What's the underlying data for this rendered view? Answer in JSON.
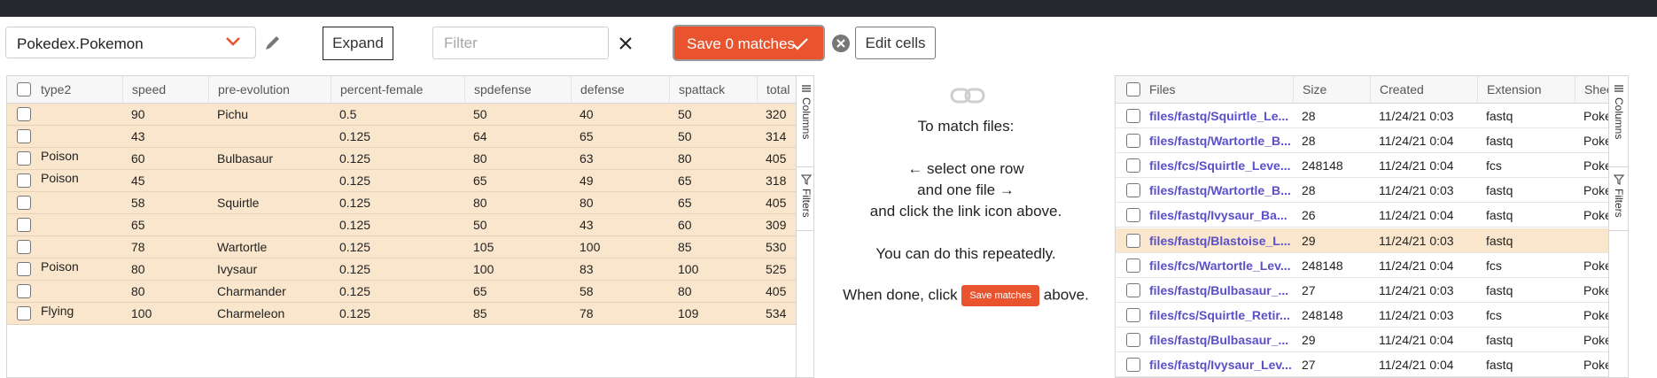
{
  "toolbar": {
    "dataset_select": "Pokedex.Pokemon",
    "expand_label": "Expand",
    "filter_placeholder": "Filter",
    "filter_value": "",
    "save_label": "Save 0 matches",
    "edit_cells_label": "Edit cells",
    "accent_color": "#e9542f"
  },
  "left_grid": {
    "columns": [
      "type2",
      "speed",
      "pre-evolution",
      "percent-female",
      "spdefense",
      "defense",
      "spattack",
      "total"
    ],
    "rows": [
      [
        "",
        "90",
        "Pichu",
        "0.5",
        "50",
        "40",
        "50",
        "320"
      ],
      [
        "",
        "43",
        "",
        "0.125",
        "64",
        "65",
        "50",
        "314"
      ],
      [
        "Poison",
        "60",
        "Bulbasaur",
        "0.125",
        "80",
        "63",
        "80",
        "405"
      ],
      [
        "Poison",
        "45",
        "",
        "0.125",
        "65",
        "49",
        "65",
        "318"
      ],
      [
        "",
        "58",
        "Squirtle",
        "0.125",
        "80",
        "80",
        "65",
        "405"
      ],
      [
        "",
        "65",
        "",
        "0.125",
        "50",
        "43",
        "60",
        "309"
      ],
      [
        "",
        "78",
        "Wartortle",
        "0.125",
        "105",
        "100",
        "85",
        "530"
      ],
      [
        "Poison",
        "80",
        "Ivysaur",
        "0.125",
        "100",
        "83",
        "100",
        "525"
      ],
      [
        "",
        "80",
        "Charmander",
        "0.125",
        "65",
        "58",
        "80",
        "405"
      ],
      [
        "Flying",
        "100",
        "Charmeleon",
        "0.125",
        "85",
        "78",
        "109",
        "534"
      ]
    ],
    "side_tabs": [
      "Columns",
      "Filters"
    ]
  },
  "instructions": {
    "line1": "To match files:",
    "line2": "← select one row",
    "line3": "and one file →",
    "line4": "and click the link icon above.",
    "line5": "You can do this repeatedly.",
    "line6_pre": "When done, click",
    "line6_button": "Save matches",
    "line6_post": "above."
  },
  "right_grid": {
    "columns": [
      "Files",
      "Size",
      "Created",
      "Extension",
      "Sheets"
    ],
    "rows": [
      {
        "file": "files/fastq/Squirtle_Le...",
        "size": "28",
        "created": "11/24/21 0:03",
        "ext": "fastq",
        "sheets": "Poked",
        "hl": false
      },
      {
        "file": "files/fastq/Wartortle_B...",
        "size": "28",
        "created": "11/24/21 0:04",
        "ext": "fastq",
        "sheets": "Poked",
        "hl": false
      },
      {
        "file": "files/fcs/Squirtle_Leve...",
        "size": "248148",
        "created": "11/24/21 0:04",
        "ext": "fcs",
        "sheets": "Poked",
        "hl": false
      },
      {
        "file": "files/fastq/Wartortle_B...",
        "size": "28",
        "created": "11/24/21 0:03",
        "ext": "fastq",
        "sheets": "Poked",
        "hl": false
      },
      {
        "file": "files/fastq/Ivysaur_Ba...",
        "size": "26",
        "created": "11/24/21 0:04",
        "ext": "fastq",
        "sheets": "Poked",
        "hl": false
      },
      {
        "file": "files/fastq/Blastoise_L...",
        "size": "29",
        "created": "11/24/21 0:03",
        "ext": "fastq",
        "sheets": "",
        "hl": true
      },
      {
        "file": "files/fcs/Wartortle_Lev...",
        "size": "248148",
        "created": "11/24/21 0:04",
        "ext": "fcs",
        "sheets": "Poked",
        "hl": false
      },
      {
        "file": "files/fastq/Bulbasaur_...",
        "size": "27",
        "created": "11/24/21 0:03",
        "ext": "fastq",
        "sheets": "Poked",
        "hl": false
      },
      {
        "file": "files/fcs/Squirtle_Retir...",
        "size": "248148",
        "created": "11/24/21 0:03",
        "ext": "fcs",
        "sheets": "Poked",
        "hl": false
      },
      {
        "file": "files/fastq/Bulbasaur_...",
        "size": "29",
        "created": "11/24/21 0:04",
        "ext": "fastq",
        "sheets": "Poked",
        "hl": false
      },
      {
        "file": "files/fastq/Ivysaur_Lev...",
        "size": "27",
        "created": "11/24/21 0:04",
        "ext": "fastq",
        "sheets": "Poked",
        "hl": false
      }
    ],
    "side_tabs": [
      "Columns",
      "Filters"
    ]
  }
}
